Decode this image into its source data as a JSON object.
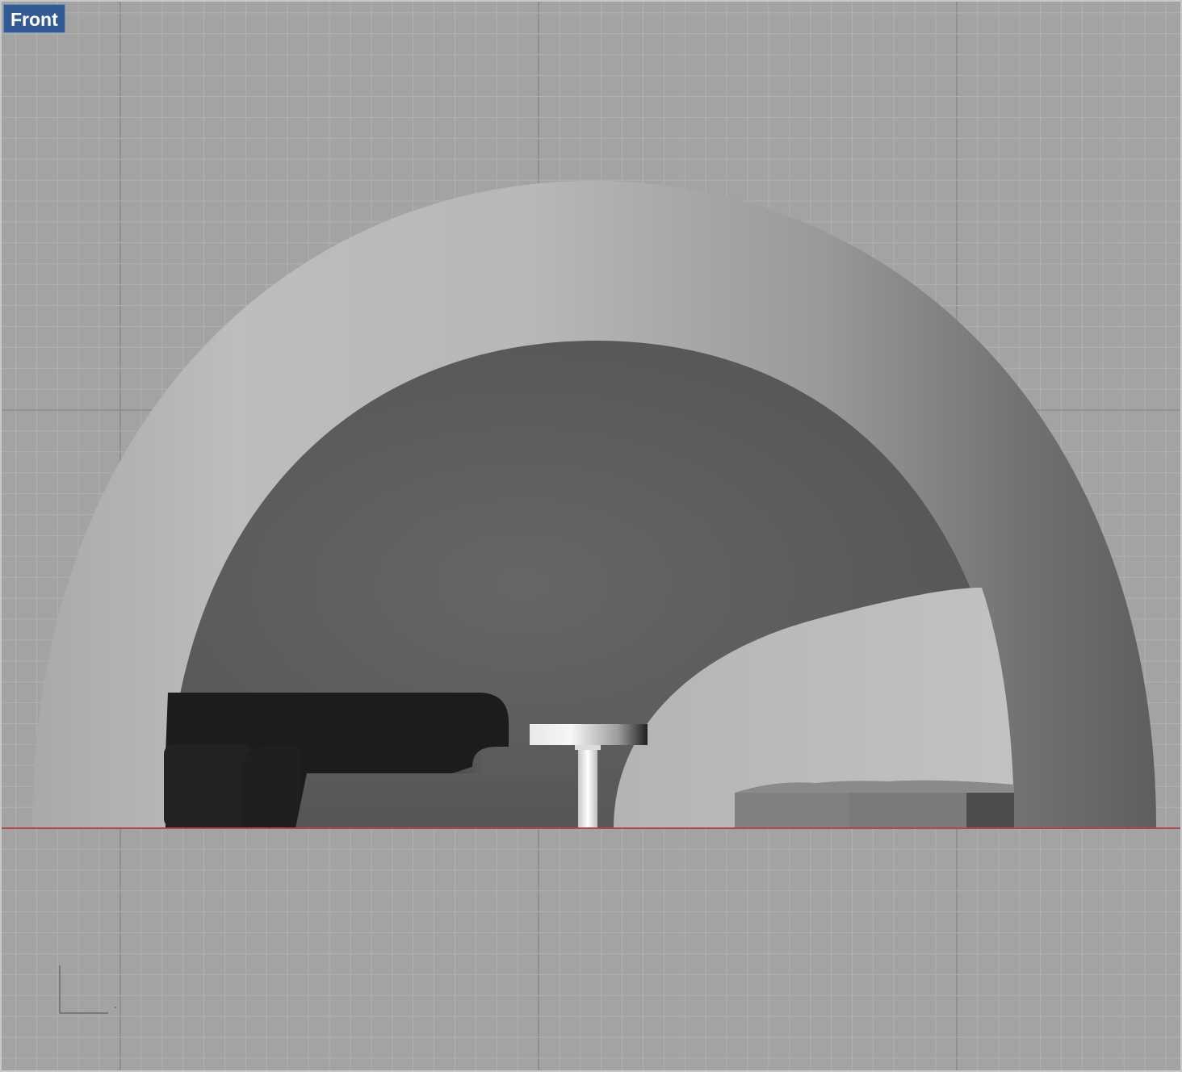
{
  "viewport": {
    "label": "Front",
    "mode": "shaded"
  },
  "colors": {
    "background": "#a3a3a3",
    "grid_minor": "#b1b1b1",
    "grid_major": "#8c8c8c",
    "x_axis": "#b5454a",
    "label_bg": "#335a93",
    "label_text": "#ffffff"
  },
  "icons": {
    "axis_widget": "axis-triad-icon"
  }
}
